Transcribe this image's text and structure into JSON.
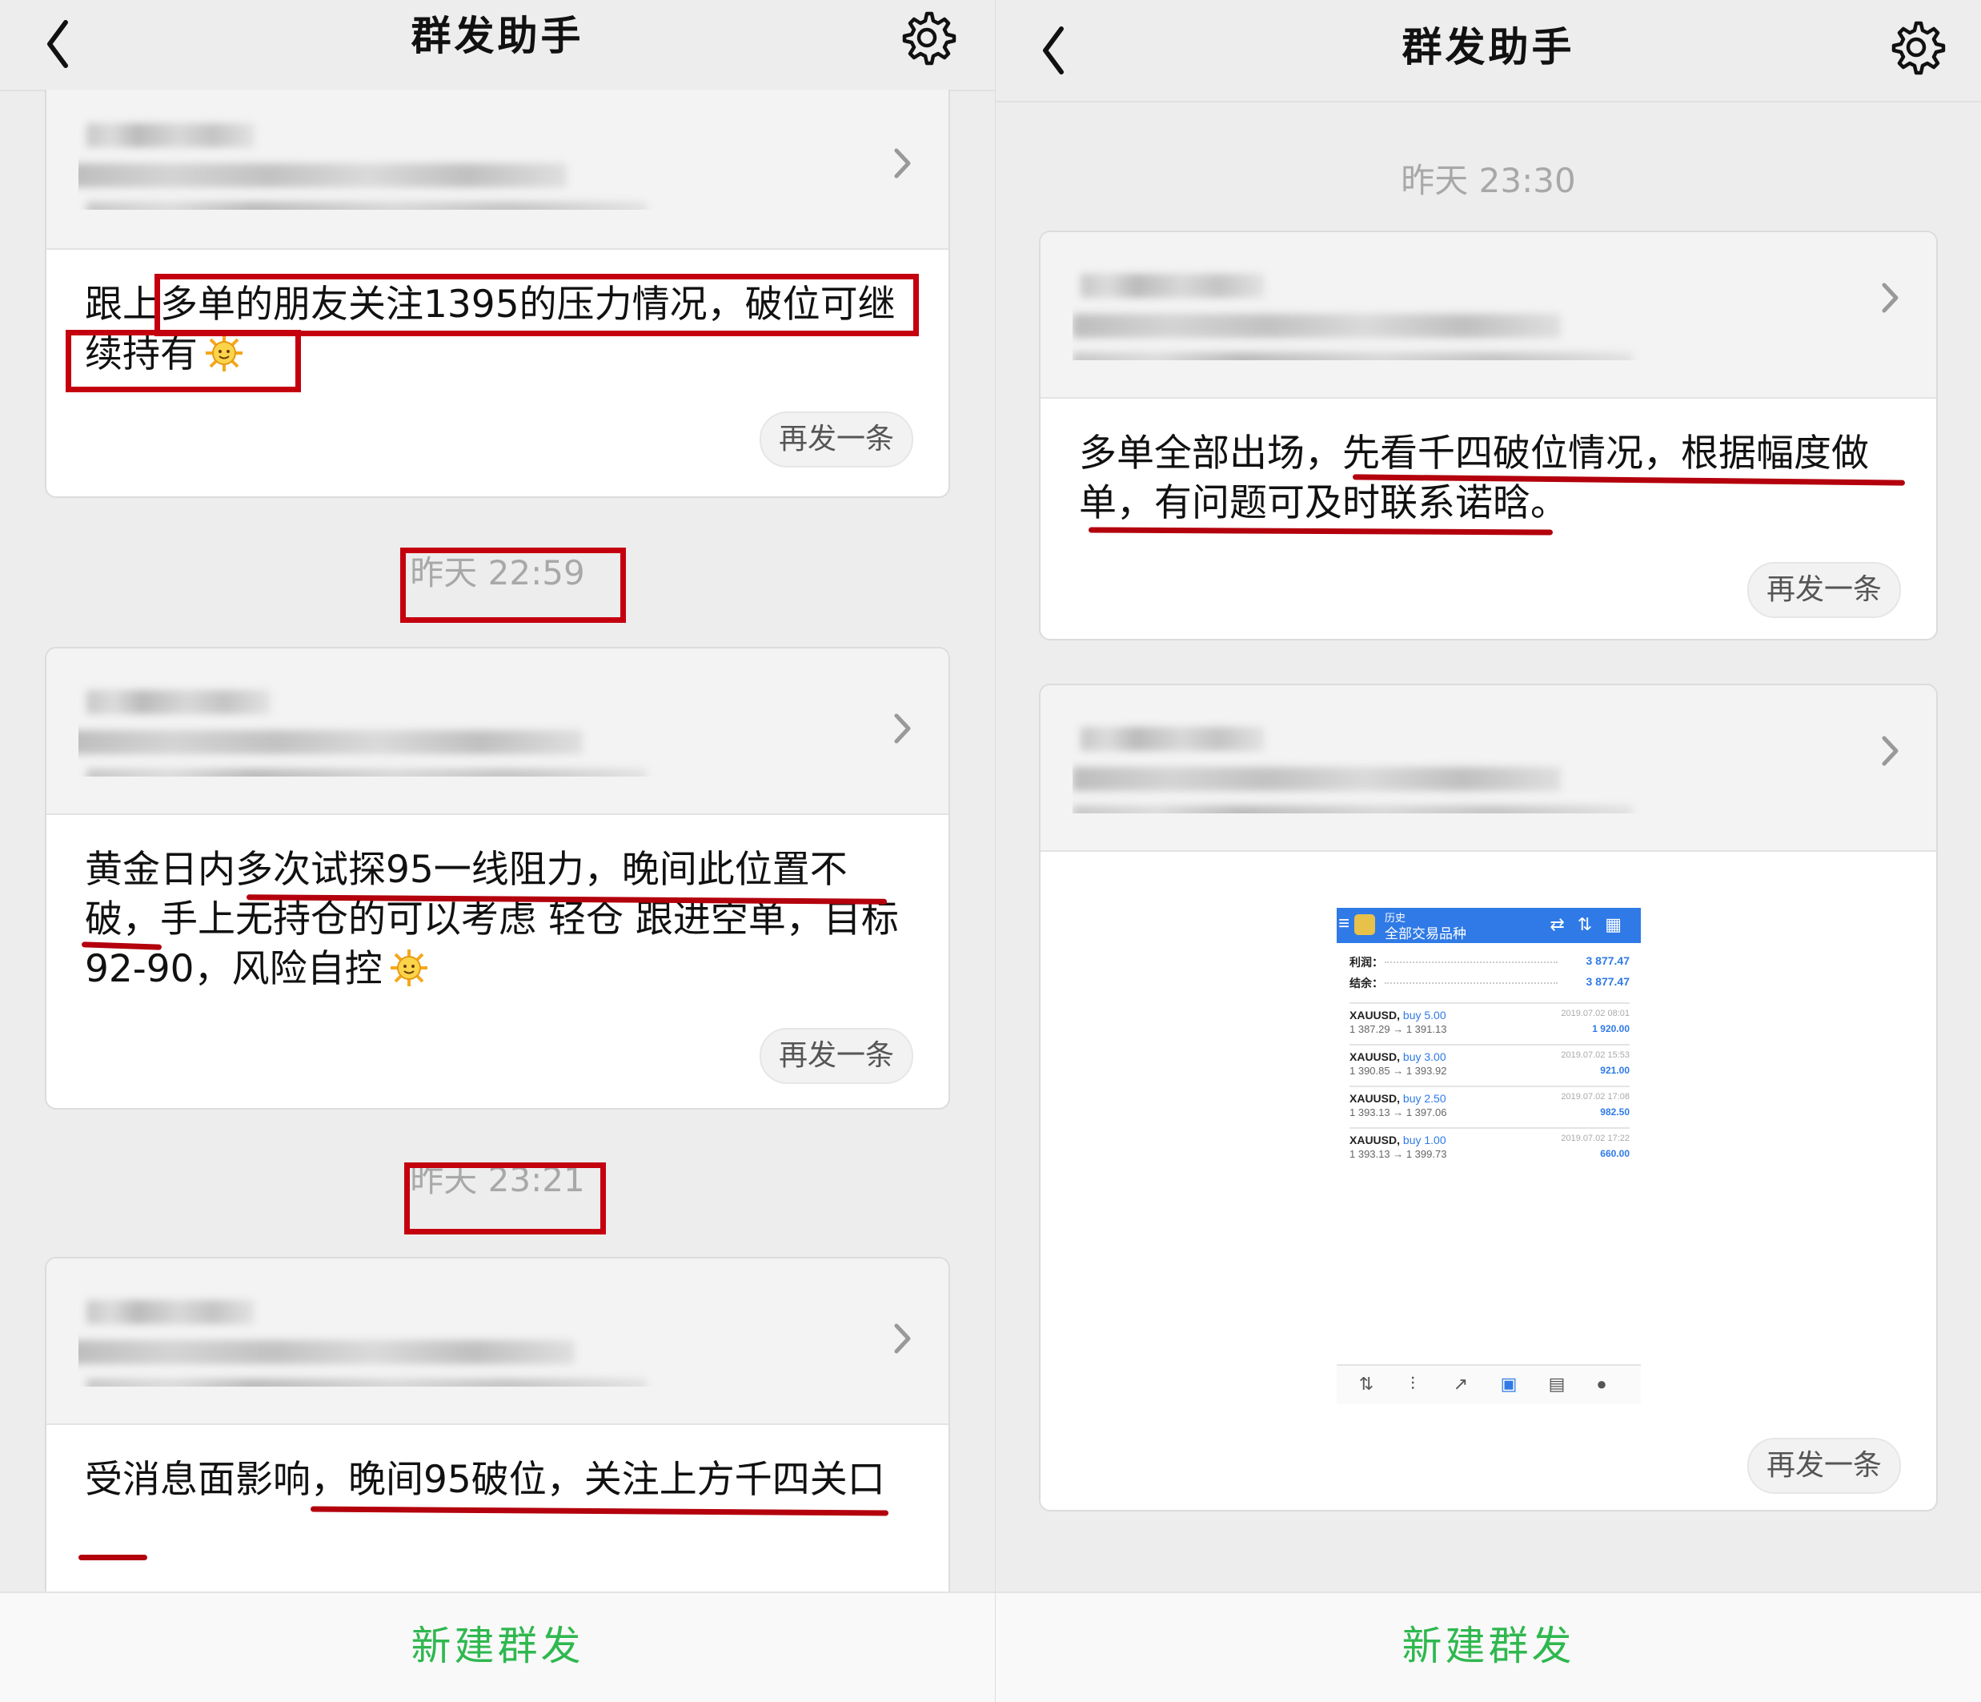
{
  "left": {
    "title": "群发助手",
    "cards": [
      {
        "message": "跟上多单的朋友关注1395的压力情况，破位可继续持有",
        "resend": "再发一条"
      },
      {
        "message": "黄金日内多次试探95一线阻力，晚间此位置不破，手上无持仓的可以考虑 轻仓 跟进空单，目标92-90，风险自控",
        "resend": "再发一条"
      },
      {
        "message": "受消息面影响，晚间95破位，关注上方千四关口"
      }
    ],
    "timestamps": [
      "昨天 22:59",
      "昨天 23:21"
    ],
    "new_button": "新建群发"
  },
  "right": {
    "title": "群发助手",
    "timestamp": "昨天 23:30",
    "cards": [
      {
        "message": "多单全部出场，先看千四破位情况，根据幅度做单，有问题可及时联系诺晗。",
        "resend": "再发一条"
      },
      {
        "resend": "再发一条",
        "screenshot": {
          "header_small": "历史",
          "header_title": "全部交易品种",
          "profit_label": "利润：",
          "profit_value": "3 877.47",
          "balance_label": "结余：",
          "balance_value": "3 877.47",
          "trades": [
            {
              "symbol": "XAUUSD,",
              "side": "buy 5.00",
              "prices": "1 387.29 → 1 391.13",
              "date": "2019.07.02 08:01",
              "profit": "1 920.00"
            },
            {
              "symbol": "XAUUSD,",
              "side": "buy 3.00",
              "prices": "1 390.85 → 1 393.92",
              "date": "2019.07.02 15:53",
              "profit": "921.00"
            },
            {
              "symbol": "XAUUSD,",
              "side": "buy 2.50",
              "prices": "1 393.13 → 1 397.06",
              "date": "2019.07.02 17:08",
              "profit": "982.50"
            },
            {
              "symbol": "XAUUSD,",
              "side": "buy 1.00",
              "prices": "1 393.13 → 1 399.73",
              "date": "2019.07.02 17:22",
              "profit": "660.00"
            }
          ]
        }
      }
    ],
    "new_button": "新建群发"
  },
  "icons": {
    "back": "chevron-left-icon",
    "settings": "gear-icon",
    "expand": "chevron-right-icon",
    "emoji": "sun-emoji-icon"
  },
  "colors": {
    "accent_green": "#2fb84f",
    "annotation_red": "#c4000f",
    "screenshot_blue": "#2f7ae6"
  }
}
